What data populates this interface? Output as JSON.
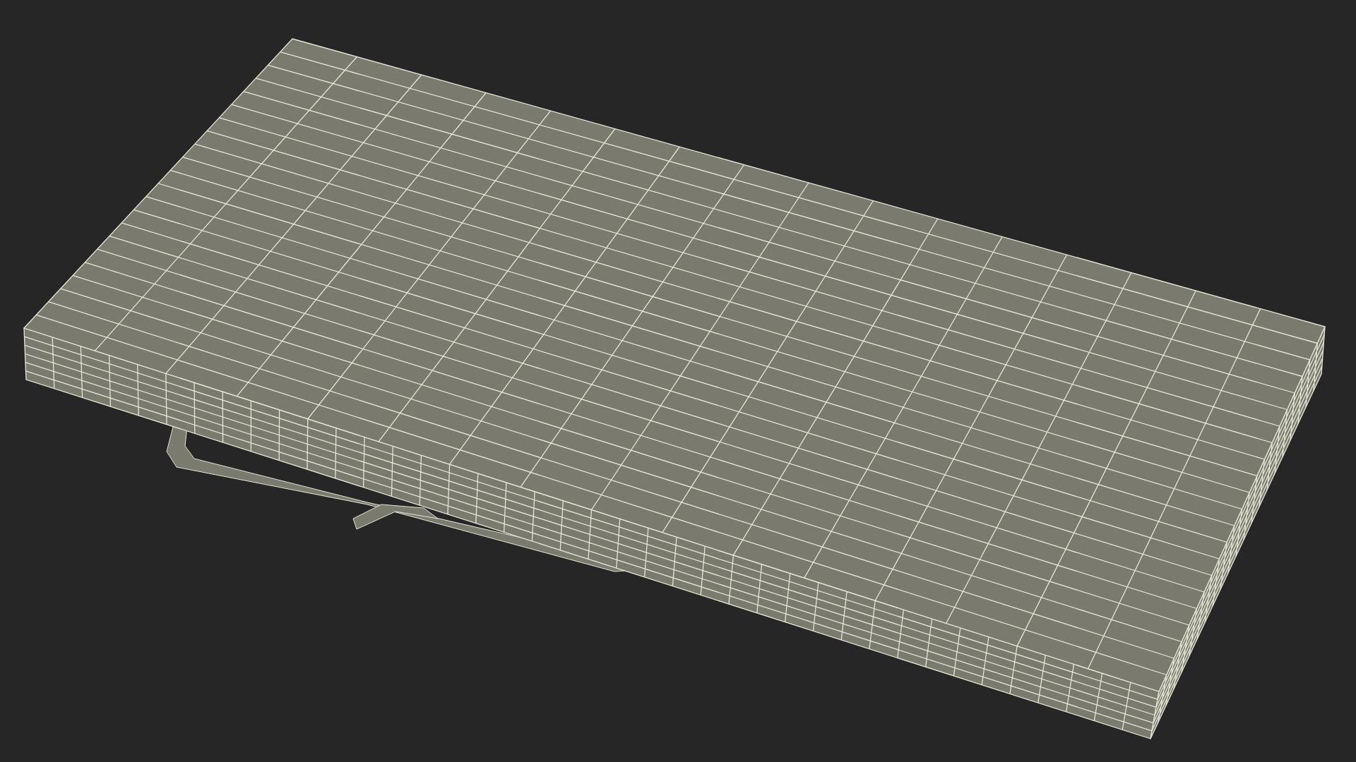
{
  "scene": {
    "kind": "wireframe"
  }
}
